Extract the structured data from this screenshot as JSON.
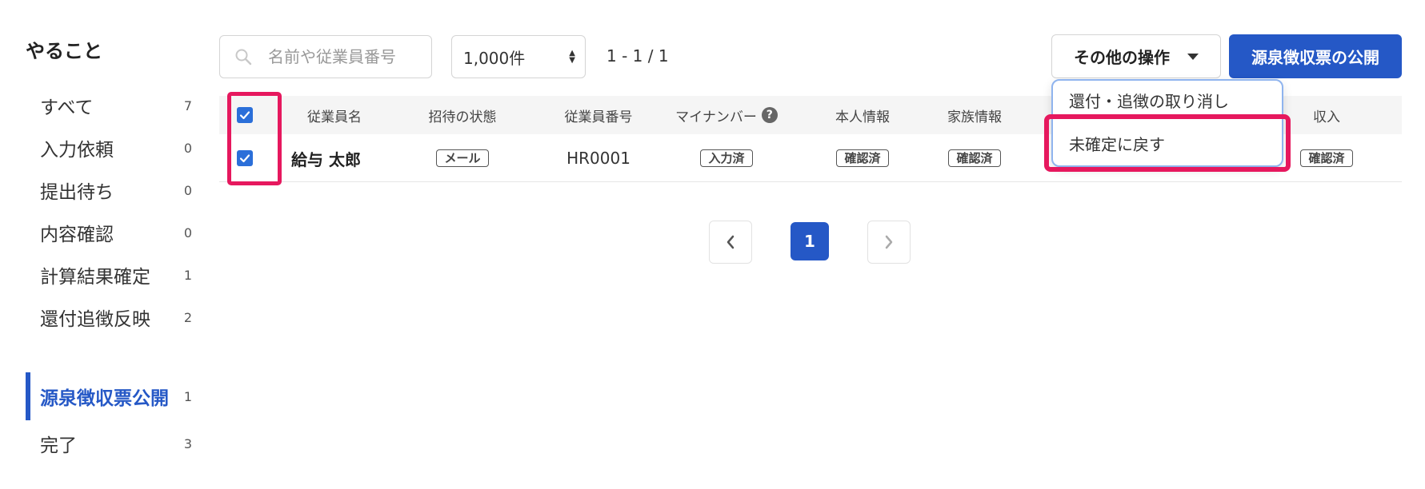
{
  "sidebar": {
    "title": "やること",
    "items": [
      {
        "label": "すべて",
        "count": "7"
      },
      {
        "label": "入力依頼",
        "count": "0"
      },
      {
        "label": "提出待ち",
        "count": "0"
      },
      {
        "label": "内容確認",
        "count": "0"
      },
      {
        "label": "計算結果確定",
        "count": "1"
      },
      {
        "label": "還付追徴反映",
        "count": "2"
      },
      {
        "label": "源泉徴収票公開",
        "count": "1"
      },
      {
        "label": "完了",
        "count": "3"
      }
    ],
    "active_item": "源泉徴収票公開"
  },
  "toolbar": {
    "search_placeholder": "名前や従業員番号",
    "per_page": "1,000件",
    "range": "1 - 1 / 1",
    "other_ops_label": "その他の操作",
    "publish_label": "源泉徴収票の公開"
  },
  "dropdown": {
    "items": [
      "還付・追徴の取り消し",
      "未確定に戻す"
    ],
    "highlighted": "未確定に戻す"
  },
  "table": {
    "headers": {
      "name": "従業員名",
      "invite": "招待の状態",
      "number": "従業員番号",
      "mynumber": "マイナンバー",
      "self_info": "本人情報",
      "family_info": "家族情報",
      "income": "収入"
    },
    "rows": [
      {
        "checked": true,
        "name": "給与 太郎",
        "invite": "メール",
        "number": "HR0001",
        "mynumber": "入力済",
        "self_info": "確認済",
        "family_info": "確認済",
        "income": "確認済"
      }
    ],
    "header_checked": true
  },
  "pagination": {
    "current": "1"
  },
  "colors": {
    "accent": "#2558c6",
    "highlight": "#e6185e",
    "checkbox": "#2b6fd9"
  }
}
